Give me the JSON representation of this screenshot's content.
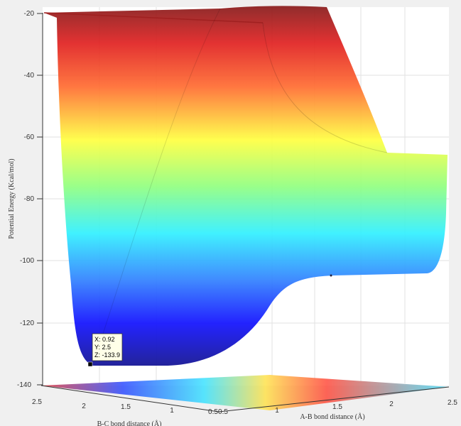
{
  "chart_data": {
    "type": "surface",
    "zlabel": "Potential Energy (Kcal/mol)",
    "xlabel": "A-B bond distance (Å)",
    "ylabel": "B-C bond distance (Å)",
    "zlim": [
      -140,
      -20
    ],
    "z_ticks": [
      "-20",
      "-40",
      "-60",
      "-80",
      "-100",
      "-120",
      "-140"
    ],
    "x_ticks": [
      "0.5",
      "1",
      "1.5",
      "2",
      "2.5"
    ],
    "y_ticks": [
      "2.5",
      "2",
      "1.5",
      "1",
      "0.5"
    ],
    "colormap": "jet",
    "grid": true,
    "datatip": {
      "x": "X: 0.92",
      "y": "Y: 2.5",
      "z": "Z: -133.9"
    },
    "colors": {
      "high": "#800000",
      "mid": "#ffff00",
      "low": "#00008f"
    }
  }
}
